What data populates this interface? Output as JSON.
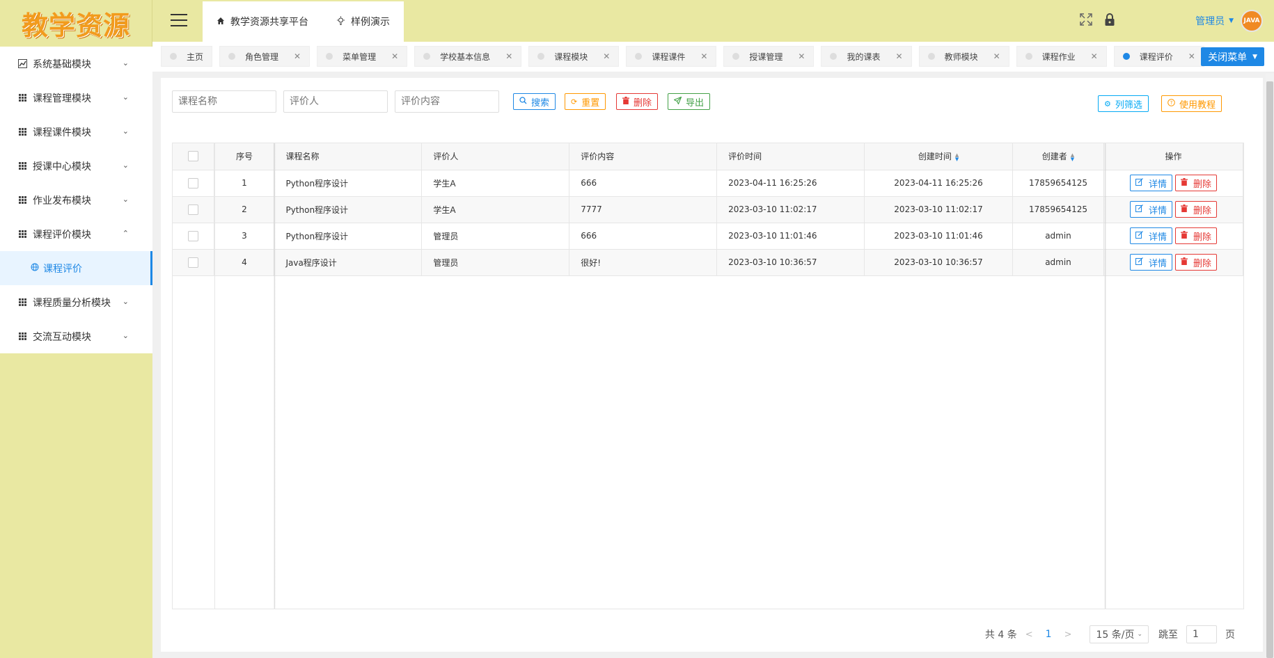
{
  "logo": {
    "text": "教学资源"
  },
  "sidebar": {
    "items": [
      {
        "label": "系统基础模块",
        "chev": "⌄"
      },
      {
        "label": "课程管理模块",
        "chev": "⌄"
      },
      {
        "label": "课程课件模块",
        "chev": "⌄"
      },
      {
        "label": "授课中心模块",
        "chev": "⌄"
      },
      {
        "label": "作业发布模块",
        "chev": "⌄"
      },
      {
        "label": "课程评价模块",
        "chev": "⌃"
      },
      {
        "label": "课程质量分析模块",
        "chev": "⌄"
      },
      {
        "label": "交流互动模块",
        "chev": "⌄"
      }
    ],
    "sub_item": {
      "label": "课程评价"
    }
  },
  "header": {
    "top_tabs": [
      {
        "label": "教学资源共享平台",
        "icon": "home-icon"
      },
      {
        "label": "样例演示",
        "icon": "bulb-icon"
      }
    ],
    "admin_name": "管理员",
    "avatar_text": "JAVA"
  },
  "tabbar": {
    "tabs": [
      {
        "label": "主页",
        "closable": false,
        "active": false
      },
      {
        "label": "角色管理",
        "closable": true,
        "active": false
      },
      {
        "label": "菜单管理",
        "closable": true,
        "active": false
      },
      {
        "label": "学校基本信息",
        "closable": true,
        "active": false
      },
      {
        "label": "课程模块",
        "closable": true,
        "active": false
      },
      {
        "label": "课程课件",
        "closable": true,
        "active": false
      },
      {
        "label": "授课管理",
        "closable": true,
        "active": false
      },
      {
        "label": "我的课表",
        "closable": true,
        "active": false
      },
      {
        "label": "教师模块",
        "closable": true,
        "active": false
      },
      {
        "label": "课程作业",
        "closable": true,
        "active": false
      },
      {
        "label": "课程评价",
        "closable": true,
        "active": true
      }
    ],
    "close_menu_label": "关闭菜单"
  },
  "search": {
    "course_name_placeholder": "课程名称",
    "reviewer_placeholder": "评价人",
    "content_placeholder": "评价内容",
    "search_label": "搜索",
    "reset_label": "重置",
    "delete_label": "删除",
    "export_label": "导出",
    "filter_label": "列筛选",
    "tutorial_label": "使用教程"
  },
  "table": {
    "headers": {
      "index": "序号",
      "course": "课程名称",
      "reviewer": "评价人",
      "content": "评价内容",
      "review_time": "评价时间",
      "create_time": "创建时间",
      "creator": "创建者",
      "ops": "操作"
    },
    "detail_label": "详情",
    "delete_label": "删除",
    "rows": [
      {
        "index": "1",
        "course": "Python程序设计",
        "reviewer": "学生A",
        "content": "666",
        "review_time": "2023-04-11 16:25:26",
        "create_time": "2023-04-11 16:25:26",
        "creator": "17859654125"
      },
      {
        "index": "2",
        "course": "Python程序设计",
        "reviewer": "学生A",
        "content": "7777",
        "review_time": "2023-03-10 11:02:17",
        "create_time": "2023-03-10 11:02:17",
        "creator": "17859654125"
      },
      {
        "index": "3",
        "course": "Python程序设计",
        "reviewer": "管理员",
        "content": "666",
        "review_time": "2023-03-10 11:01:46",
        "create_time": "2023-03-10 11:01:46",
        "creator": "admin"
      },
      {
        "index": "4",
        "course": "Java程序设计",
        "reviewer": "管理员",
        "content": "很好!",
        "review_time": "2023-03-10 10:36:57",
        "create_time": "2023-03-10 10:36:57",
        "creator": "admin"
      }
    ]
  },
  "pager": {
    "total": "共 4 条",
    "current_page": "1",
    "page_size": "15 条/页",
    "jump_label": "跳至",
    "jump_value": "1",
    "page_unit": "页"
  },
  "colors": {
    "sidebar_bg": "#e9e8a2",
    "accent": "#1e88e5",
    "logo": "#f29b1d"
  }
}
